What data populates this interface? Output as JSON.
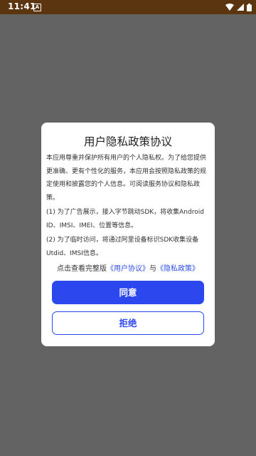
{
  "status_bar": {
    "time": "11:41",
    "notification_glyph": "A",
    "icons": [
      "wifi-icon",
      "signal-icon",
      "battery-icon"
    ]
  },
  "dialog": {
    "title": "用户隐私政策协议",
    "paragraphs": [
      " 本应用尊重并保护所有用户的个人隐私权。为了给您提供更准确、更有个性化的服务，本应用会按照隐私政策的规定使用和披露您的个人信息。可阅读服务协议和隐私政策。",
      " (1) 为了广告展示，接入字节跳动SDK，将收集Android ID、IMSI、IMEI、位置等信息。",
      " (2) 为了临时访问，将通过阿里设备标识SDK收集设备Utdid、IMSI信息。"
    ],
    "links_prefix": "点击查看完整版",
    "user_agreement_link": "《用户协议》",
    "links_joiner": "与",
    "privacy_policy_link": "《隐私政策》",
    "agree_label": "同意",
    "reject_label": "拒绝"
  },
  "colors": {
    "status_bar_bg": "#5b3510",
    "scrim": "#636363",
    "accent": "#2d47ef",
    "link": "#2d4de6"
  }
}
